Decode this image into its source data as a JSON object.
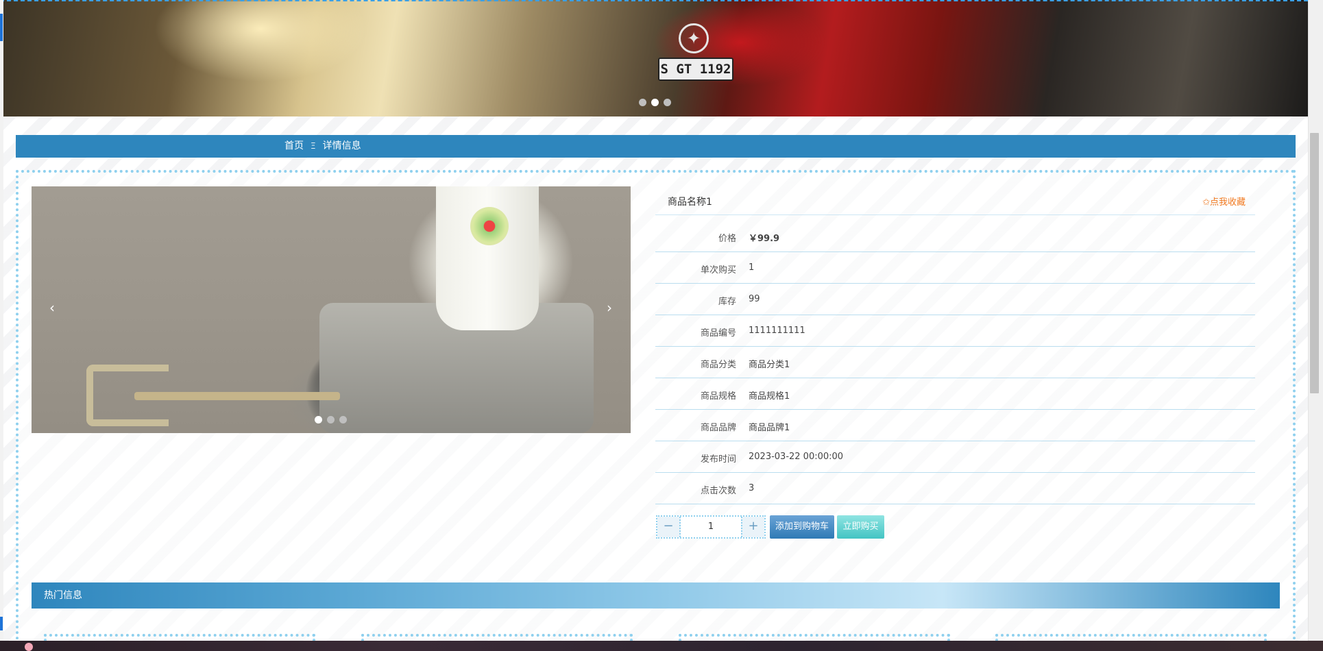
{
  "hero": {
    "plate_text": "S GT 1192",
    "logo_text": "✦",
    "dot_count": 3,
    "active_dot": 1
  },
  "breadcrumb": {
    "home": "首页",
    "separator": "Ξ",
    "current": "详情信息"
  },
  "gallery": {
    "prev_glyph": "‹",
    "next_glyph": "›",
    "active_dot": 0,
    "dot_count": 3
  },
  "product": {
    "name": "商品名称1",
    "collect_label": "✩点我收藏",
    "fields": [
      {
        "label": "价格",
        "value": "￥99.9"
      },
      {
        "label": "单次购买",
        "value": "1"
      },
      {
        "label": "库存",
        "value": "99"
      },
      {
        "label": "商品编号",
        "value": "1111111111"
      },
      {
        "label": "商品分类",
        "value": "商品分类1"
      },
      {
        "label": "商品规格",
        "value": "商品规格1"
      },
      {
        "label": "商品品牌",
        "value": "商品品牌1"
      },
      {
        "label": "发布时间",
        "value": "2023-03-22 00:00:00"
      },
      {
        "label": "点击次数",
        "value": "3"
      }
    ]
  },
  "actions": {
    "minus": "−",
    "quantity": "1",
    "plus": "+",
    "add_to_cart": "添加到购物车",
    "buy_now": "立即购买"
  },
  "hot": {
    "title": "热门信息"
  },
  "colors": {
    "primary": "#2e86bd",
    "dotted_border": "#8fd0ee",
    "collect": "#f0781e",
    "cart_button": "#2f7ab5",
    "buy_button": "#43c4c3"
  }
}
